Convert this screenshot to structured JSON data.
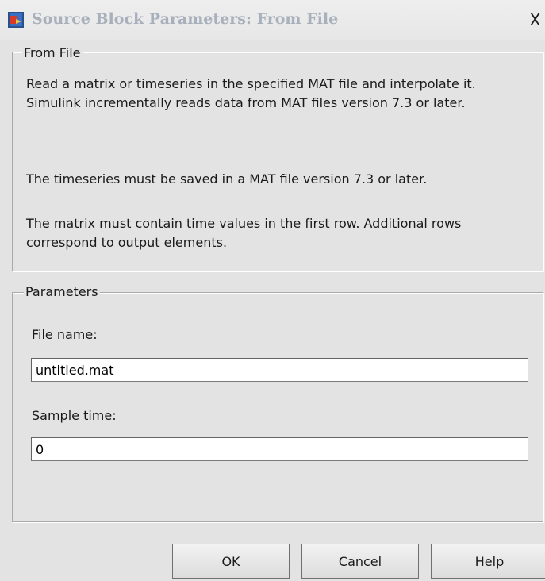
{
  "window": {
    "title": "Source Block Parameters: From File",
    "close_label": "X",
    "icon": "simulink-block-icon"
  },
  "from_file": {
    "legend": "From File",
    "description": [
      "Read a matrix or timeseries in the specified MAT file and interpolate it. Simulink incrementally reads data from MAT files version 7.3 or later.",
      "The timeseries must be saved in a MAT file version 7.3 or later.",
      "The matrix must contain time values in the first row. Additional rows correspond to output elements."
    ]
  },
  "parameters": {
    "legend": "Parameters",
    "file_name": {
      "label": "File name:",
      "value": "untitled.mat"
    },
    "sample_time": {
      "label": "Sample time:",
      "value": "0"
    }
  },
  "buttons": {
    "ok": "OK",
    "cancel": "Cancel",
    "help": "Help"
  }
}
